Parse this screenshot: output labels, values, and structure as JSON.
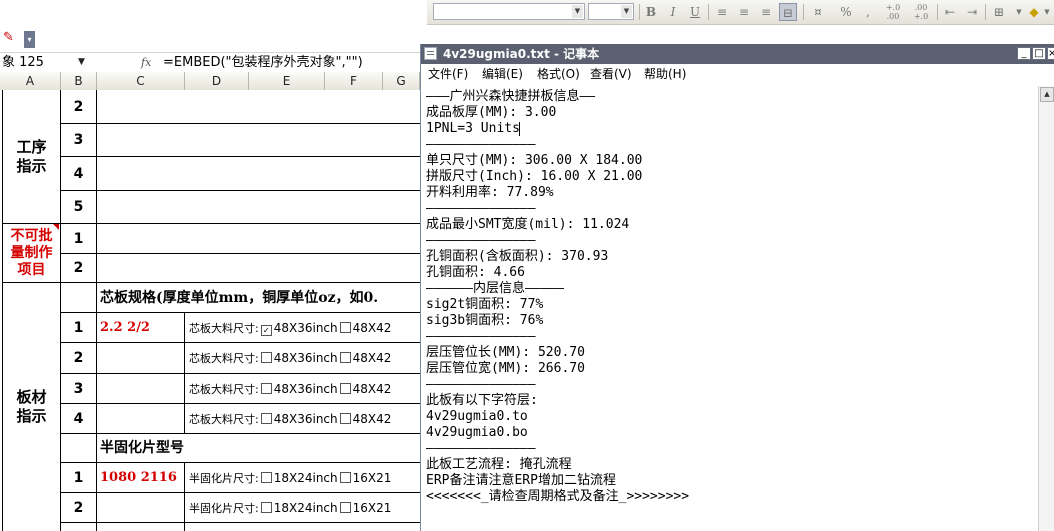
{
  "toolbar": {
    "buttons": {
      "bold": "B",
      "italic": "I",
      "underline": "U",
      "percent": "%",
      "comma": ",",
      "inc_decimal": "+.0 .00",
      "dec_decimal": ".00 +.0"
    },
    "icons": [
      "bold-icon",
      "italic-icon",
      "underline-icon",
      "align-left-icon",
      "align-center-icon",
      "align-right-icon",
      "merge-center-icon",
      "currency-icon",
      "percent-icon",
      "comma-icon",
      "increase-decimal-icon",
      "decrease-decimal-icon",
      "decrease-indent-icon",
      "increase-indent-icon",
      "borders-icon",
      "fill-color-icon"
    ]
  },
  "formula_bar": {
    "namebox": "象 125",
    "fx": "fx",
    "formula": "=EMBED(\"包装程序外壳对象\",\"\")"
  },
  "sheet": {
    "columns": [
      "A",
      "B",
      "C",
      "D",
      "E",
      "F",
      "G"
    ],
    "sections": {
      "process": "工序指示",
      "no_batch": "不可批量制作项目",
      "board": "板材指示"
    },
    "row_numbers": {
      "p1": "2",
      "p2": "3",
      "p3": "4",
      "p4": "5",
      "nb1": "1",
      "nb2": "2",
      "b1": "1",
      "b2": "2",
      "b3": "3",
      "b4": "4",
      "s1": "1",
      "s2": "2"
    },
    "core_spec_header": "芯板规格(厚度单位mm，铜厚单位oz，如0.",
    "core_values": {
      "r1": "2.2 2/2"
    },
    "core_size_label": "芯板大料尺寸:",
    "core_size_opt1": "48X36inch",
    "core_size_opt2": "48X42",
    "prepreg_header": "半固化片型号",
    "prepreg_value": "1080 2116",
    "prepreg_size_label": "半固化片尺寸:",
    "prepreg_opt1": "18X24inch",
    "prepreg_opt2": "16X21"
  },
  "notepad": {
    "title": "4v29ugmia0.txt - 记事本",
    "window_buttons": {
      "minimize": "_",
      "maximize": "□",
      "close": "×"
    },
    "menu": [
      "文件(F)",
      "编辑(E)",
      "格式(O)",
      "查看(V)",
      "帮助(H)"
    ],
    "lines": [
      "———广州兴森快捷拼板信息——",
      "成品板厚(MM): 3.00",
      "1PNL=3 Units",
      "——————————————",
      "单只尺寸(MM): 306.00 X 184.00",
      "拼版尺寸(Inch): 16.00 X 21.00",
      "开料利用率: 77.89%",
      "——————————————",
      "成品最小SMT宽度(mil): 11.024",
      "——————————————",
      "孔铜面积(含板面积): 370.93",
      "孔铜面积: 4.66",
      "——————内层信息—————",
      "sig2t铜面积: 77%",
      "sig3b铜面积: 76%",
      "——————————————",
      "层压管位长(MM): 520.70",
      "层压管位宽(MM): 266.70",
      "——————————————",
      "此板有以下字符层:",
      "4v29ugmia0.to",
      "4v29ugmia0.bo",
      "——————————————",
      "此板工艺流程: 掩孔流程",
      "ERP备注请注意ERP增加二钻流程",
      "<<<<<<<_请检查周期格式及备注_>>>>>>>>"
    ]
  },
  "colors": {
    "accent_red": "#d40000",
    "titlebar": "#5a6070"
  }
}
